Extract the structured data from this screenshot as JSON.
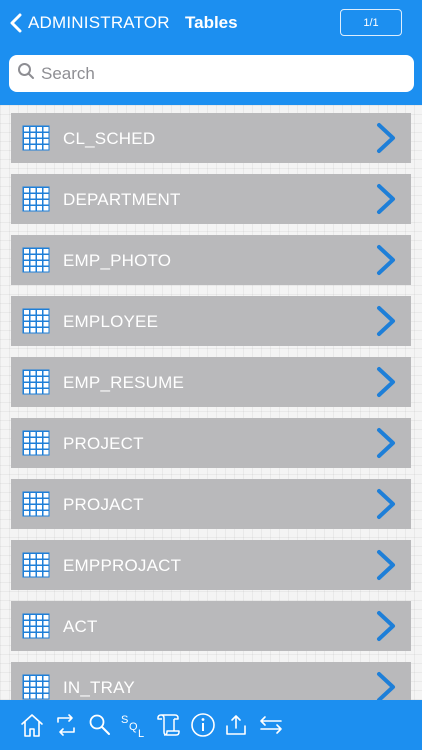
{
  "header": {
    "back_label": "ADMINISTRATOR",
    "title": "Tables",
    "page_indicator": "1/1"
  },
  "search": {
    "placeholder": "Search",
    "value": ""
  },
  "tables": [
    {
      "name": "CL_SCHED"
    },
    {
      "name": "DEPARTMENT"
    },
    {
      "name": "EMP_PHOTO"
    },
    {
      "name": "EMPLOYEE"
    },
    {
      "name": "EMP_RESUME"
    },
    {
      "name": "PROJECT"
    },
    {
      "name": "PROJACT"
    },
    {
      "name": "EMPPROJACT"
    },
    {
      "name": "ACT"
    },
    {
      "name": "IN_TRAY"
    }
  ],
  "toolbar": {
    "items": [
      {
        "icon": "home-icon"
      },
      {
        "icon": "refresh-icon"
      },
      {
        "icon": "search-icon"
      },
      {
        "icon": "sql-icon",
        "text": "SQL"
      },
      {
        "icon": "scroll-icon"
      },
      {
        "icon": "info-icon"
      },
      {
        "icon": "upload-icon"
      },
      {
        "icon": "transfer-icon"
      }
    ]
  },
  "colors": {
    "accent": "#1c8ff0",
    "row_bg": "#b9b9bb",
    "icon_blue": "#1e7fd8"
  }
}
